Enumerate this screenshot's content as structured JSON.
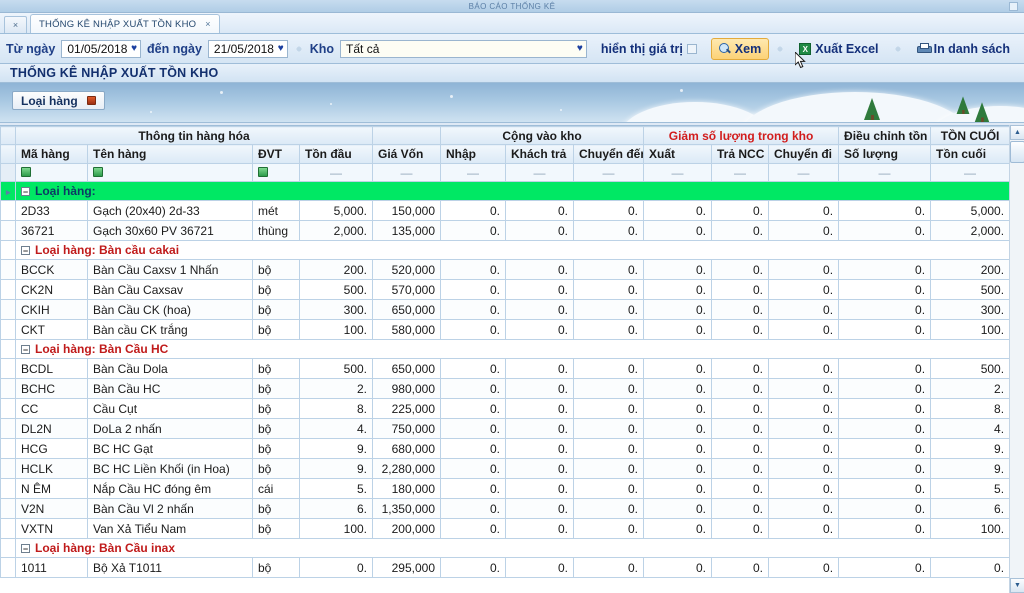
{
  "window": {
    "caption": "BÁO CÁO THỐNG KÊ"
  },
  "tabbar": {
    "close_all": "×",
    "tabs": [
      {
        "label": "THỐNG KÊ NHẬP XUẤT TỒN KHO",
        "close": "×"
      }
    ]
  },
  "toolbar": {
    "from_label": "Từ ngày",
    "from_value": "01/05/2018",
    "to_label": "đến ngày",
    "to_value": "21/05/2018",
    "warehouse_label": "Kho",
    "warehouse_value": "Tất cả",
    "show_value_label": "hiển thị giá trị",
    "view_label": "Xem",
    "export_excel_label": "Xuất Excel",
    "print_label": "In danh sách",
    "caret": "♥",
    "excel_glyph": "X"
  },
  "report": {
    "title": "THỐNG KÊ NHẬP XUẤT TỒN KHO"
  },
  "grouppanel": {
    "field": "Loại hàng"
  },
  "grid": {
    "groups": [
      {
        "label": "Thông tin hàng hóa",
        "span": 5,
        "color": "#16357e"
      },
      {
        "label": "Cộng vào kho",
        "span": 3,
        "color": "#16357e"
      },
      {
        "label": "Giảm số lượng trong kho",
        "span": 3,
        "color": "#d21d1d"
      },
      {
        "label": "Điều chỉnh tồn",
        "span": 1,
        "color": "#16357e"
      },
      {
        "label": "TỒN CUỐI",
        "span": 1,
        "color": "#16357e"
      }
    ],
    "columns": [
      "Mã hàng",
      "Tên hàng",
      "ĐVT",
      "Tồn đầu",
      "Giá Vốn",
      "Nhập",
      "Khách trả",
      "Chuyển đến",
      "Xuất",
      "Trả NCC",
      "Chuyển đi",
      "Số lượng",
      "Tồn cuối"
    ],
    "filter_row": [
      "filter-icon",
      "filter-icon",
      "filter-icon",
      "—",
      "—",
      "—",
      "—",
      "—",
      "—",
      "—",
      "—",
      "—",
      "—"
    ],
    "group_label_prefix": "Loại hàng:",
    "rows": [
      {
        "type": "group",
        "selected": true,
        "label": "Loại hàng:"
      },
      {
        "type": "data",
        "cells": [
          "2D33",
          "Gạch (20x40) 2d-33",
          "mét",
          "5,000.",
          "150,000",
          "0.",
          "0.",
          "0.",
          "0.",
          "0.",
          "0.",
          "0.",
          "5,000."
        ]
      },
      {
        "type": "data",
        "cells": [
          "36721",
          "Gạch 30x60 PV 36721",
          "thùng",
          "2,000.",
          "135,000",
          "0.",
          "0.",
          "0.",
          "0.",
          "0.",
          "0.",
          "0.",
          "2,000."
        ]
      },
      {
        "type": "group",
        "selected": false,
        "label": "Loại hàng: Bàn cầu cakai"
      },
      {
        "type": "data",
        "cells": [
          "BCCK",
          "Bàn Cầu Caxsv 1 Nhấn",
          "bộ",
          "200.",
          "520,000",
          "0.",
          "0.",
          "0.",
          "0.",
          "0.",
          "0.",
          "0.",
          "200."
        ]
      },
      {
        "type": "data",
        "cells": [
          "CK2N",
          "Bàn Cầu Caxsav",
          "bộ",
          "500.",
          "570,000",
          "0.",
          "0.",
          "0.",
          "0.",
          "0.",
          "0.",
          "0.",
          "500."
        ]
      },
      {
        "type": "data",
        "cells": [
          "CKIH",
          "Bàn Cầu CK (hoa)",
          "bộ",
          "300.",
          "650,000",
          "0.",
          "0.",
          "0.",
          "0.",
          "0.",
          "0.",
          "0.",
          "300."
        ]
      },
      {
        "type": "data",
        "cells": [
          "CKT",
          "Bàn cầu CK trắng",
          "bộ",
          "100.",
          "580,000",
          "0.",
          "0.",
          "0.",
          "0.",
          "0.",
          "0.",
          "0.",
          "100."
        ]
      },
      {
        "type": "group",
        "selected": false,
        "label": "Loại hàng: Bàn Cầu HC"
      },
      {
        "type": "data",
        "cells": [
          "BCDL",
          "Bàn Cầu Dola",
          "bộ",
          "500.",
          "650,000",
          "0.",
          "0.",
          "0.",
          "0.",
          "0.",
          "0.",
          "0.",
          "500."
        ]
      },
      {
        "type": "data",
        "cells": [
          "BCHC",
          "Bàn Cầu HC",
          "bộ",
          "2.",
          "980,000",
          "0.",
          "0.",
          "0.",
          "0.",
          "0.",
          "0.",
          "0.",
          "2."
        ]
      },
      {
        "type": "data",
        "cells": [
          "CC",
          "Cầu Cụt",
          "bộ",
          "8.",
          "225,000",
          "0.",
          "0.",
          "0.",
          "0.",
          "0.",
          "0.",
          "0.",
          "8."
        ]
      },
      {
        "type": "data",
        "cells": [
          "DL2N",
          "DoLa 2 nhấn",
          "bộ",
          "4.",
          "750,000",
          "0.",
          "0.",
          "0.",
          "0.",
          "0.",
          "0.",
          "0.",
          "4."
        ]
      },
      {
        "type": "data",
        "cells": [
          "HCG",
          "BC HC Gạt",
          "bộ",
          "9.",
          "680,000",
          "0.",
          "0.",
          "0.",
          "0.",
          "0.",
          "0.",
          "0.",
          "9."
        ]
      },
      {
        "type": "data",
        "cells": [
          "HCLK",
          "BC HC Liền Khối (in Hoa)",
          "bộ",
          "9.",
          "2,280,000",
          "0.",
          "0.",
          "0.",
          "0.",
          "0.",
          "0.",
          "0.",
          "9."
        ]
      },
      {
        "type": "data",
        "cells": [
          "N ÊM",
          "Nắp Cầu HC đóng êm",
          "cái",
          "5.",
          "180,000",
          "0.",
          "0.",
          "0.",
          "0.",
          "0.",
          "0.",
          "0.",
          "5."
        ]
      },
      {
        "type": "data",
        "cells": [
          "V2N",
          "Bàn Cầu Vl 2 nhấn",
          "bộ",
          "6.",
          "1,350,000",
          "0.",
          "0.",
          "0.",
          "0.",
          "0.",
          "0.",
          "0.",
          "6."
        ]
      },
      {
        "type": "data",
        "cells": [
          "VXTN",
          "Van Xả Tiểu Nam",
          "bộ",
          "100.",
          "200,000",
          "0.",
          "0.",
          "0.",
          "0.",
          "0.",
          "0.",
          "0.",
          "100."
        ]
      },
      {
        "type": "group",
        "selected": false,
        "label": "Loại hàng: Bàn Cầu inax"
      },
      {
        "type": "data",
        "cells": [
          "1011",
          "Bộ Xả T1011",
          "bộ",
          "0.",
          "295,000",
          "0.",
          "0.",
          "0.",
          "0.",
          "0.",
          "0.",
          "0.",
          "0."
        ]
      }
    ]
  },
  "scrollbar": {
    "up": "▲",
    "down": "▼"
  },
  "colors": {
    "accent": "#16357e",
    "warn": "#d21d1d",
    "selection": "#00e864",
    "button_active": "#fcd277"
  }
}
